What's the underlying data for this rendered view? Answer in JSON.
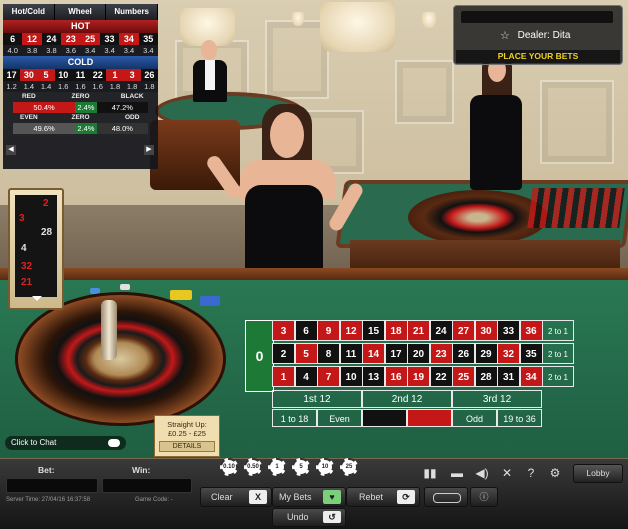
{
  "stats": {
    "tabs": [
      "Hot/Cold",
      "Wheel",
      "Numbers"
    ],
    "hot_title": "HOT",
    "hot_numbers": [
      {
        "n": "6",
        "c": "blk"
      },
      {
        "n": "12",
        "c": "red"
      },
      {
        "n": "24",
        "c": "blk"
      },
      {
        "n": "23",
        "c": "red"
      },
      {
        "n": "25",
        "c": "red"
      },
      {
        "n": "33",
        "c": "blk"
      },
      {
        "n": "34",
        "c": "red"
      },
      {
        "n": "35",
        "c": "blk"
      }
    ],
    "hot_counts": [
      "4.0",
      "3.8",
      "3.8",
      "3.6",
      "3.4",
      "3.4",
      "3.4",
      "3.4"
    ],
    "cold_title": "COLD",
    "cold_numbers": [
      {
        "n": "17",
        "c": "blk"
      },
      {
        "n": "30",
        "c": "red"
      },
      {
        "n": "5",
        "c": "red"
      },
      {
        "n": "10",
        "c": "blk"
      },
      {
        "n": "11",
        "c": "blk"
      },
      {
        "n": "22",
        "c": "blk"
      },
      {
        "n": "1",
        "c": "red"
      },
      {
        "n": "3",
        "c": "red"
      },
      {
        "n": "26",
        "c": "blk"
      }
    ],
    "cold_counts": [
      "1.2",
      "1.4",
      "1.4",
      "1.6",
      "1.6",
      "1.6",
      "1.8",
      "1.8",
      "1.8"
    ],
    "row1_heads": [
      "RED",
      "ZERO",
      "BLACK"
    ],
    "row1_values": [
      "50.4%",
      "2.4%",
      "47.2%"
    ],
    "row2_heads": [
      "EVEN",
      "ZERO",
      "ODD"
    ],
    "row2_values": [
      "49.6%",
      "2.4%",
      "48.0%"
    ]
  },
  "history": [
    {
      "n": "2",
      "c": "#e02020"
    },
    {
      "n": "3",
      "c": "#e02020"
    },
    {
      "n": "28",
      "c": "#e0e0e0"
    },
    {
      "n": "4",
      "c": "#e0e0e0"
    },
    {
      "n": "32",
      "c": "#e02020"
    },
    {
      "n": "21",
      "c": "#e02020"
    }
  ],
  "dealer": {
    "name": "Dealer: Dita",
    "place_bets": "PLACE YOUR BETS"
  },
  "layout": {
    "zero": "0",
    "rows": [
      [
        {
          "n": "3",
          "c": "red"
        },
        {
          "n": "6",
          "c": "blk"
        },
        {
          "n": "9",
          "c": "red"
        },
        {
          "n": "12",
          "c": "red"
        },
        {
          "n": "15",
          "c": "blk"
        },
        {
          "n": "18",
          "c": "red"
        },
        {
          "n": "21",
          "c": "red"
        },
        {
          "n": "24",
          "c": "blk"
        },
        {
          "n": "27",
          "c": "red"
        },
        {
          "n": "30",
          "c": "red"
        },
        {
          "n": "33",
          "c": "blk"
        },
        {
          "n": "36",
          "c": "red"
        }
      ],
      [
        {
          "n": "2",
          "c": "blk"
        },
        {
          "n": "5",
          "c": "red"
        },
        {
          "n": "8",
          "c": "blk"
        },
        {
          "n": "11",
          "c": "blk"
        },
        {
          "n": "14",
          "c": "red"
        },
        {
          "n": "17",
          "c": "blk"
        },
        {
          "n": "20",
          "c": "blk"
        },
        {
          "n": "23",
          "c": "red"
        },
        {
          "n": "26",
          "c": "blk"
        },
        {
          "n": "29",
          "c": "blk"
        },
        {
          "n": "32",
          "c": "red"
        },
        {
          "n": "35",
          "c": "blk"
        }
      ],
      [
        {
          "n": "1",
          "c": "red"
        },
        {
          "n": "4",
          "c": "blk"
        },
        {
          "n": "7",
          "c": "red"
        },
        {
          "n": "10",
          "c": "blk"
        },
        {
          "n": "13",
          "c": "blk"
        },
        {
          "n": "16",
          "c": "red"
        },
        {
          "n": "19",
          "c": "red"
        },
        {
          "n": "22",
          "c": "blk"
        },
        {
          "n": "25",
          "c": "red"
        },
        {
          "n": "28",
          "c": "blk"
        },
        {
          "n": "31",
          "c": "blk"
        },
        {
          "n": "34",
          "c": "red"
        }
      ]
    ],
    "column_bet": "2 to 1",
    "dozens": [
      "1st 12",
      "2nd 12",
      "3rd 12"
    ],
    "outside": [
      "1 to 18",
      "Even",
      "",
      "",
      "Odd",
      "19 to 36"
    ]
  },
  "chat_label": "Click to Chat",
  "limits": {
    "line1": "Straight Up:",
    "line2": "£0.25 - £25",
    "details": "DETAILS"
  },
  "chips": [
    "0.10",
    "0.50",
    "1",
    "5",
    "10",
    "25"
  ],
  "bottom": {
    "bet_label": "Bet:",
    "win_label": "Win:",
    "server_time": "Server Time: 27/04/16 16:37:58",
    "game_code": "Game Code: -",
    "clear": "Clear",
    "my_bets": "My Bets",
    "rebet": "Rebet",
    "undo": "Undo",
    "lobby": "Lobby"
  },
  "colors": {
    "red": "#c41818",
    "black": "#111111",
    "green": "#1c7a34",
    "gold_text": "#f0d020"
  }
}
